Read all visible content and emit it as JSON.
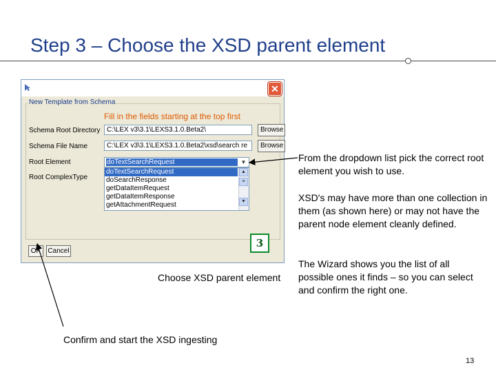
{
  "slide": {
    "title": "Step 3 – Choose the XSD parent element",
    "page_number": "13"
  },
  "dialog": {
    "group_title": "New Template from Schema",
    "hint": "Fill in the fields starting at the top first",
    "close_glyph": "✕",
    "labels": {
      "schema_root_directory": "Schema Root Directory",
      "schema_file_name": "Schema File Name",
      "root_element": "Root Element",
      "root_complex_type": "Root ComplexType"
    },
    "fields": {
      "schema_root_directory": "C:\\LEX v3\\3.1\\LEXS3.1.0.Beta2\\",
      "schema_file_name": "C:\\LEX v3\\3.1\\LEXS3.1.0.Beta2\\xsd\\search re"
    },
    "browse_label": "Browse",
    "root_element_selected": "doTextSearchRequest",
    "root_element_options": [
      "doTextSearchRequest",
      "doSearchResponse",
      "getDataItemRequest",
      "getDataItemResponse",
      "getAttachmentRequest"
    ],
    "ok_label": "OK",
    "cancel_label": "Cancel"
  },
  "badge": {
    "number": "3"
  },
  "callouts": {
    "dropdown": "From the dropdown list pick the correct root element you wish to use.",
    "collections": "XSD's may have more than one collection in them (as shown here) or may not have the parent node element cleanly defined.",
    "wizard": "The Wizard shows you the list of all possible ones it finds – so you can select and confirm the right one."
  },
  "captions": {
    "choose": "Choose XSD parent element",
    "confirm": "Confirm and start the XSD ingesting"
  }
}
